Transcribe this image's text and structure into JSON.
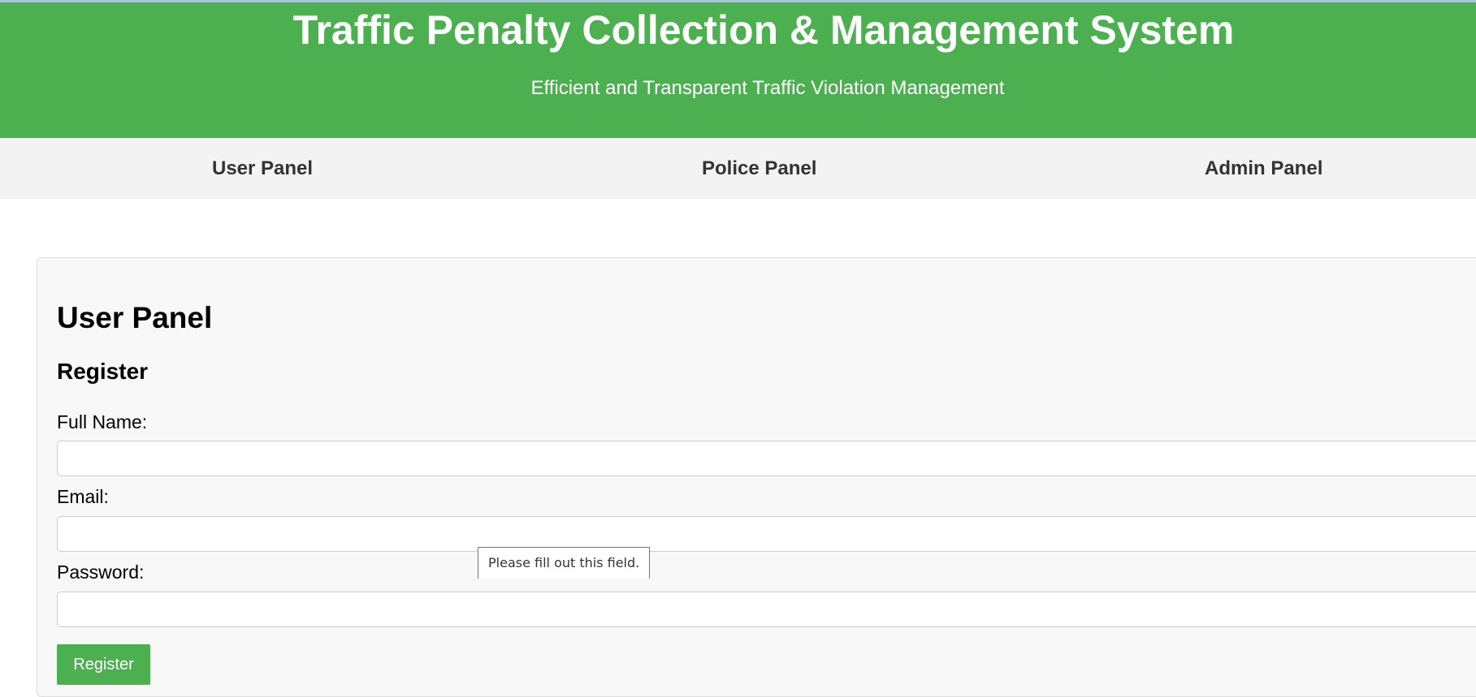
{
  "header": {
    "title": "Traffic Penalty Collection & Management System",
    "subtitle": "Efficient and Transparent Traffic Violation Management"
  },
  "nav": {
    "items": [
      {
        "label": "User Panel"
      },
      {
        "label": "Police Panel"
      },
      {
        "label": "Admin Panel"
      }
    ]
  },
  "panel": {
    "title": "User Panel",
    "section": "Register",
    "fields": [
      {
        "label": "Full Name:",
        "value": ""
      },
      {
        "label": "Email:",
        "value": ""
      },
      {
        "label": "Password:",
        "value": ""
      }
    ],
    "submit_label": "Register"
  },
  "validation": {
    "message": "Please fill out this field."
  },
  "colors": {
    "header_bg": "#4caf50",
    "nav_bg": "#f3f3f3",
    "card_bg": "#f8f8f8",
    "button_bg": "#4caf50"
  }
}
